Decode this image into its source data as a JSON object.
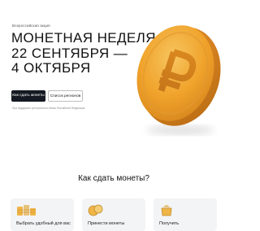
{
  "hero": {
    "eyebrow": "Всероссийская акция",
    "title_lines": [
      "МОНЕТНАЯ НЕДЕЛЯ",
      "22 СЕНТЯБРЯ —",
      "4 ОКТЯБРЯ"
    ],
    "primary_button": "Как сдать монеты",
    "secondary_button": "Список регионов",
    "footnote": "При поддержке Центрального банка Российской Федерации",
    "coin_color": "#f0a32b"
  },
  "how_to": {
    "title": "Как сдать монеты?",
    "cards": [
      {
        "icon": "coin-stack-icon",
        "text": "Выбрать удобный для вас"
      },
      {
        "icon": "coins-icon",
        "text": "Принести монеты"
      },
      {
        "icon": "bag-icon",
        "text": "Получить"
      }
    ]
  }
}
